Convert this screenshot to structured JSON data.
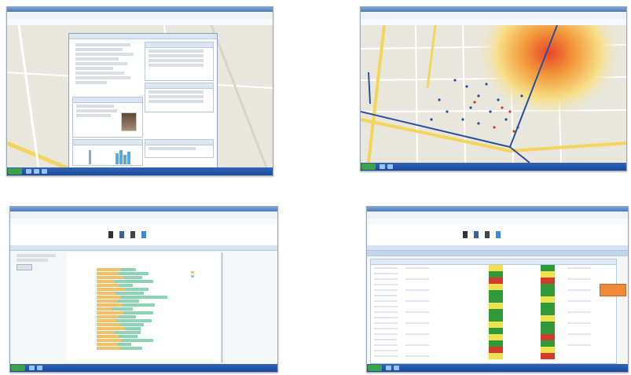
{
  "screenshots": [
    {
      "name": "employee-profile-window"
    },
    {
      "name": "map-heatmap-window"
    },
    {
      "name": "horizontal-bar-report-window"
    },
    {
      "name": "color-coded-table-window"
    }
  ],
  "colors": {
    "window_title": "#4a78b8",
    "taskbar": "#1c4a9a",
    "map_bg": "#e9e6de",
    "road_yellow": "#f2d55a",
    "route_blue": "#2a4f9c",
    "bar_orange": "#f3c06a",
    "bar_teal": "#8fd3b6",
    "table_green": "#2e9a3a",
    "table_yellow": "#f2e04a",
    "table_red": "#d33a2a",
    "highlight_orange": "#f08a3a"
  },
  "icons": [
    "report-toolbar-icon-1",
    "report-toolbar-icon-2",
    "report-toolbar-icon-3",
    "report-toolbar-icon-4"
  ]
}
